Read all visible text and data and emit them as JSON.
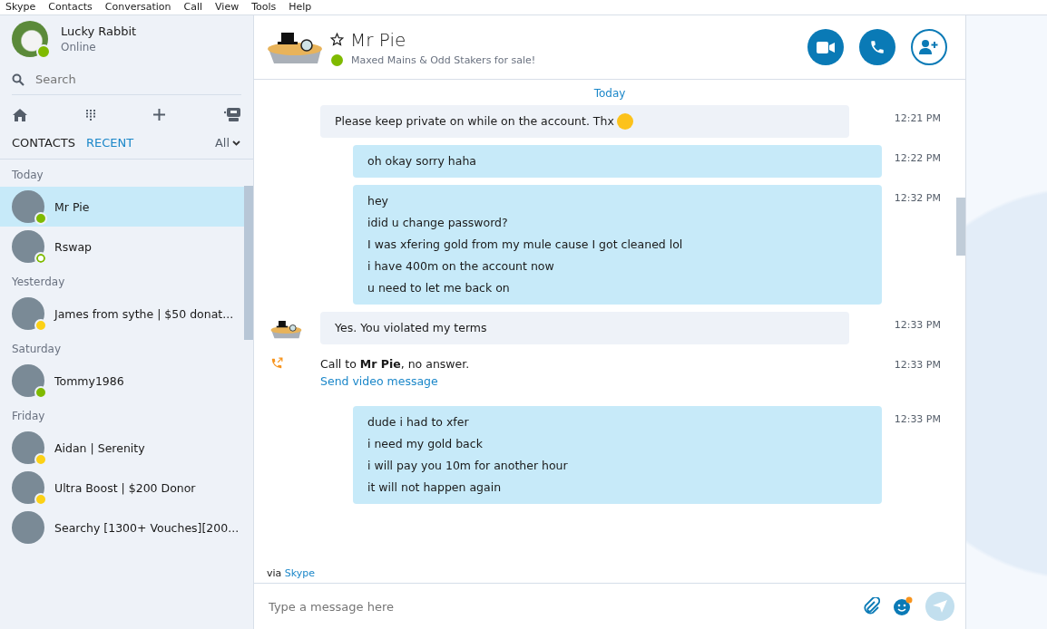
{
  "menu": [
    "Skype",
    "Contacts",
    "Conversation",
    "Call",
    "View",
    "Tools",
    "Help"
  ],
  "profile": {
    "name": "Lucky Rabbit",
    "status_text": "Online",
    "color": "#7fba00",
    "ring": false
  },
  "search": {
    "placeholder": "Search"
  },
  "tabs": [
    {
      "label": "CONTACTS",
      "selected": false
    },
    {
      "label": "RECENT",
      "selected": true
    }
  ],
  "filter": "All",
  "groups": [
    {
      "label": "Today",
      "contacts": [
        {
          "name": "Mr Pie",
          "color": "#7fba00",
          "ring": false,
          "selected": true
        },
        {
          "name": "Rswap",
          "color": "#7fba00",
          "ring": true,
          "selected": false
        }
      ]
    },
    {
      "label": "Yesterday",
      "contacts": [
        {
          "name": "James from sythe | $50 donat...",
          "color": "#fcd116",
          "ring": false,
          "selected": false
        }
      ]
    },
    {
      "label": "Saturday",
      "contacts": [
        {
          "name": "Tommy1986",
          "color": "#7fba00",
          "ring": false,
          "selected": false
        }
      ]
    },
    {
      "label": "Friday",
      "contacts": [
        {
          "name": "Aidan | Serenity",
          "color": "#fcd116",
          "ring": false,
          "selected": false
        },
        {
          "name": "Ultra Boost | $200 Donor",
          "color": "#fcd116",
          "ring": false,
          "selected": false
        },
        {
          "name": "Searchy [1300+ Vouches][200...",
          "selected": false
        }
      ]
    }
  ],
  "chat": {
    "name": "Mr Pie",
    "mood": "Maxed Mains & Odd Stakers for sale!",
    "color": "#7fba00",
    "day": "Today",
    "messages": [
      {
        "kind": "incoming",
        "avatar": false,
        "lines": [
          "Please keep private on while on the account. Thx"
        ],
        "emoji": true,
        "time": "12:21 PM"
      },
      {
        "kind": "outgoing",
        "lines": [
          "oh okay sorry haha"
        ],
        "time": "12:22 PM"
      },
      {
        "kind": "outgoing",
        "lines": [
          "hey",
          "idid u change password?",
          "I was xfering gold from my mule cause I got cleaned lol",
          "i have 400m on the account now",
          "u need to let me back on"
        ],
        "time": "12:32 PM"
      },
      {
        "kind": "incoming",
        "avatar": true,
        "lines": [
          "Yes. You violated my terms"
        ],
        "emoji": false,
        "time": "12:33 PM"
      },
      {
        "kind": "call",
        "text": "Call to **Mr Pie**, no answer.",
        "link": "Send video message",
        "time": "12:33 PM"
      },
      {
        "kind": "outgoing",
        "lines": [
          "dude i had to xfer",
          "i need my gold back",
          "i will pay you 10m for another hour",
          "it will not happen again"
        ],
        "time": "12:33 PM"
      }
    ],
    "via": "via",
    "via_link": "Skype",
    "placeholder": "Type a message here"
  }
}
